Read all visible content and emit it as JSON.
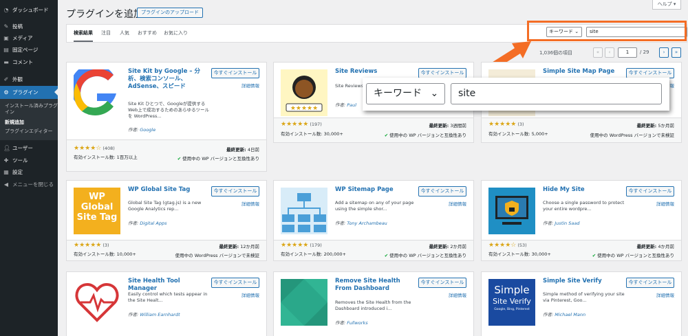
{
  "sidebar": {
    "items": [
      {
        "icon": "dashboard-icon",
        "label": "ダッシュボード"
      },
      {
        "icon": "pin-icon",
        "label": "投稿"
      },
      {
        "icon": "media-icon",
        "label": "メディア"
      },
      {
        "icon": "page-icon",
        "label": "固定ページ"
      },
      {
        "icon": "comment-icon",
        "label": "コメント"
      },
      {
        "icon": "appearance-icon",
        "label": "外観"
      },
      {
        "icon": "plugin-icon",
        "label": "プラグイン"
      },
      {
        "icon": "users-icon",
        "label": "ユーザー"
      },
      {
        "icon": "tools-icon",
        "label": "ツール"
      },
      {
        "icon": "settings-icon",
        "label": "設定"
      },
      {
        "icon": "collapse-icon",
        "label": "メニューを閉じる"
      }
    ],
    "submenu": [
      "インストール済みプラグイン",
      "新規追加",
      "プラグインエディター"
    ]
  },
  "header": {
    "title": "プラグインを追加",
    "upload_label": "プラグインのアップロード",
    "help_label": "ヘルプ"
  },
  "filter": {
    "tabs": [
      "検索結果",
      "注目",
      "人気",
      "おすすめ",
      "お気に入り"
    ],
    "type_select": "キーワード",
    "search_value": "site"
  },
  "pagination": {
    "items_count": "1,036個の項目",
    "first": "«",
    "prev": "‹",
    "current_page": "1",
    "total_pages": "/ 29",
    "next": "›",
    "last": "»"
  },
  "zoom": {
    "type_select": "キーワード",
    "search_value": "site"
  },
  "labels": {
    "install": "今すぐインストール",
    "details": "詳細情報",
    "by": "作者: ",
    "last_updated": "最終更新:",
    "compatible": "使用中の WP バージョンと互換性あり",
    "untested": "使用中の WordPress バージョンで未検証"
  },
  "plugins": [
    {
      "name": "Site Kit by Google – 分析、検索コンソール、AdSense、スピード",
      "desc": "Site Kit ひとつで、Googleが提供するWeb上で成功するためのあらゆるツールを WordPress...",
      "author": "Google",
      "stars": "★★★★☆",
      "rating_count": "(408)",
      "installs": "有効インストール数: 1百万以上",
      "updated": "4日前",
      "compat": "compatible",
      "thumb": "google"
    },
    {
      "name": "Site Reviews",
      "desc": "Site Reviews ... and displa...",
      "author": "Paul",
      "stars": "★★★★★",
      "rating_count": "(197)",
      "installs": "有効インストール数: 30,000+",
      "updated": "3週間前",
      "compat": "compatible",
      "thumb": "reviews"
    },
    {
      "name": "Simple Site Map Page",
      "desc": "",
      "author": "",
      "stars": "★★★★★",
      "rating_count": "(3)",
      "installs": "有効インストール数: 5,000+",
      "updated": "5か月前",
      "compat": "untested",
      "thumb": "sitemappage"
    },
    {
      "name": "WP Global Site Tag",
      "desc": "Global Site Tag (gtag.js) is a new Google Analytics rep...",
      "author": "Digital Apps",
      "stars": "★★★★★",
      "rating_count": "(3)",
      "installs": "有効インストール数: 10,000+",
      "updated": "12か月前",
      "compat": "untested",
      "thumb": "gtag",
      "thumb_text": [
        "WP",
        "Global",
        "Site Tag"
      ]
    },
    {
      "name": "WP Sitemap Page",
      "desc": "Add a sitemap on any of your page using the simple shor...",
      "author": "Tony Archambeau",
      "stars": "★★★★★",
      "rating_count": "(179)",
      "installs": "有効インストール数: 200,000+",
      "updated": "2か月前",
      "compat": "compatible",
      "thumb": "sitemap"
    },
    {
      "name": "Hide My Site",
      "desc": "Choose a single password to protect your entire wordpre...",
      "author": "Justin Saad",
      "stars": "★★★★☆",
      "rating_count": "(53)",
      "installs": "有効インストール数: 30,000+",
      "updated": "4か月前",
      "compat": "compatible",
      "thumb": "hide"
    },
    {
      "name": "Site Health Tool Manager",
      "desc": "Easily control which tests appear in the Site Healt...",
      "author": "William Earnhardt",
      "thumb": "health"
    },
    {
      "name": "Remove Site Health From Dashboard",
      "desc": "Removes the Site Health from the Dashboard introduced i...",
      "author": "Fullworks",
      "thumb": "remove"
    },
    {
      "name": "Simple Site Verify",
      "desc": "Simple method of verifying your site via Pinterest, Goo...",
      "author": "Michael Mann",
      "thumb": "verify",
      "thumb_text": [
        "Simple",
        "Site Verify",
        "Google, Bing, Pinterest"
      ]
    }
  ],
  "colors": {
    "accent": "#2271b1",
    "highlight": "#f46d25",
    "star": "#dba617",
    "admin_bar": "#1d2327"
  }
}
